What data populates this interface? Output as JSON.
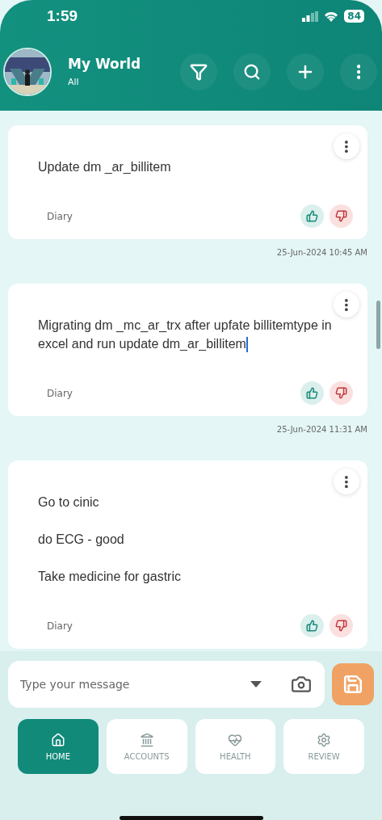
{
  "status_bar": {
    "time": "1:59",
    "battery": "84"
  },
  "header": {
    "title": "My World",
    "subtitle": "All"
  },
  "notes": [
    {
      "paragraphs": [
        "Update dm _ar_billitem"
      ],
      "category": "Diary",
      "timestamp": "25-Jun-2024 10:45 AM",
      "cursor": false
    },
    {
      "paragraphs": [
        "Migrating dm _mc_ar_trx after upfate billitemtype in excel and run update  dm_ar_billitem"
      ],
      "category": "Diary",
      "timestamp": "25-Jun-2024 11:31 AM",
      "cursor": true
    },
    {
      "paragraphs": [
        "Go to cinic",
        "do ECG - good",
        "Take medicine for gastric"
      ],
      "category": "Diary",
      "cursor": false
    }
  ],
  "composer": {
    "placeholder": "Type your message"
  },
  "nav": [
    {
      "kind": "home",
      "label": "HOME",
      "selected": true
    },
    {
      "kind": "accounts",
      "label": "ACCOUNTS",
      "selected": false
    },
    {
      "kind": "health",
      "label": "HEALTH",
      "selected": false
    },
    {
      "kind": "review",
      "label": "REVIEW",
      "selected": false
    }
  ]
}
